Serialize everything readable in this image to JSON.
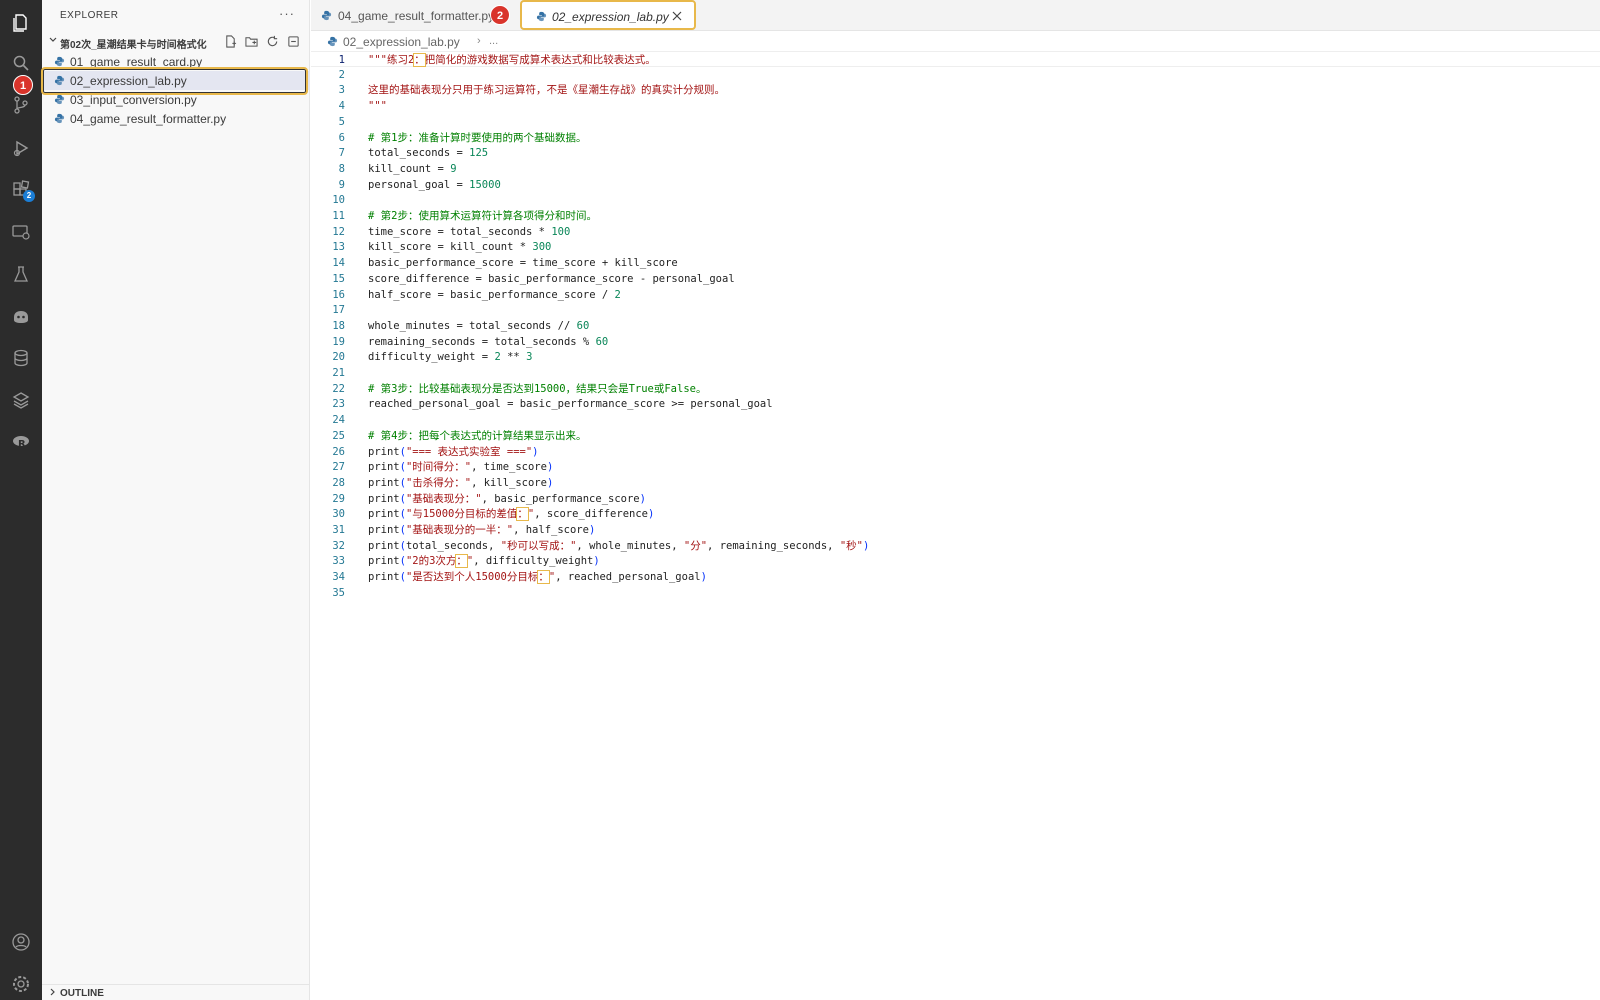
{
  "sidebar": {
    "title": "EXPLORER",
    "more": "···",
    "folder": "第02次_星潮结果卡与时间格式化",
    "files": [
      {
        "name": "01_game_result_card.py"
      },
      {
        "name": "02_expression_lab.py"
      },
      {
        "name": "03_input_conversion.py"
      },
      {
        "name": "04_game_result_formatter.py"
      }
    ],
    "outline": "OUTLINE"
  },
  "activity": {
    "extensions_badge": "2"
  },
  "markers": {
    "m1": "1",
    "m2": "2"
  },
  "tabs": [
    {
      "label": "04_game_result_formatter.py"
    },
    {
      "label": "02_expression_lab.py"
    }
  ],
  "breadcrumb": {
    "file": "02_expression_lab.py",
    "sep": "›",
    "more": "..."
  },
  "editor": {
    "lines": [
      {
        "n": "1",
        "t": [
          [
            "s",
            "\"\"\"练习2"
          ],
          [
            "b",
            "："
          ],
          [
            "s",
            "把简化的游戏数据写成算术表达式和比较表达式。"
          ]
        ]
      },
      {
        "n": "2",
        "t": []
      },
      {
        "n": "3",
        "t": [
          [
            "s",
            "这里的基础表现分只用于练习运算符，不是《星潮生存战》的真实计分规则。"
          ]
        ]
      },
      {
        "n": "4",
        "t": [
          [
            "s",
            "\"\"\""
          ]
        ]
      },
      {
        "n": "5",
        "t": []
      },
      {
        "n": "6",
        "t": [
          [
            "c",
            "# 第1步：准备计算时要使用的两个基础数据。"
          ]
        ]
      },
      {
        "n": "7",
        "t": [
          [
            "p",
            "total_seconds = "
          ],
          [
            "n",
            "125"
          ]
        ]
      },
      {
        "n": "8",
        "t": [
          [
            "p",
            "kill_count = "
          ],
          [
            "n",
            "9"
          ]
        ]
      },
      {
        "n": "9",
        "t": [
          [
            "p",
            "personal_goal = "
          ],
          [
            "n",
            "15000"
          ]
        ]
      },
      {
        "n": "10",
        "t": []
      },
      {
        "n": "11",
        "t": [
          [
            "c",
            "# 第2步：使用算术运算符计算各项得分和时间。"
          ]
        ]
      },
      {
        "n": "12",
        "t": [
          [
            "p",
            "time_score = total_seconds * "
          ],
          [
            "n",
            "100"
          ]
        ]
      },
      {
        "n": "13",
        "t": [
          [
            "p",
            "kill_score = kill_count * "
          ],
          [
            "n",
            "300"
          ]
        ]
      },
      {
        "n": "14",
        "t": [
          [
            "p",
            "basic_performance_score = time_score + kill_score"
          ]
        ]
      },
      {
        "n": "15",
        "t": [
          [
            "p",
            "score_difference = basic_performance_score - personal_goal"
          ]
        ]
      },
      {
        "n": "16",
        "t": [
          [
            "p",
            "half_score = basic_performance_score / "
          ],
          [
            "n",
            "2"
          ]
        ]
      },
      {
        "n": "17",
        "t": []
      },
      {
        "n": "18",
        "t": [
          [
            "p",
            "whole_minutes = total_seconds // "
          ],
          [
            "n",
            "60"
          ]
        ]
      },
      {
        "n": "19",
        "t": [
          [
            "p",
            "remaining_seconds = total_seconds % "
          ],
          [
            "n",
            "60"
          ]
        ]
      },
      {
        "n": "20",
        "t": [
          [
            "p",
            "difficulty_weight = "
          ],
          [
            "n",
            "2"
          ],
          [
            "p",
            " ** "
          ],
          [
            "n",
            "3"
          ]
        ]
      },
      {
        "n": "21",
        "t": []
      },
      {
        "n": "22",
        "t": [
          [
            "c",
            "# 第3步：比较基础表现分是否达到15000，结果只会是True或False。"
          ]
        ]
      },
      {
        "n": "23",
        "t": [
          [
            "p",
            "reached_personal_goal = basic_performance_score >= personal_goal"
          ]
        ]
      },
      {
        "n": "24",
        "t": []
      },
      {
        "n": "25",
        "t": [
          [
            "c",
            "# 第4步：把每个表达式的计算结果显示出来。"
          ]
        ]
      },
      {
        "n": "26",
        "t": [
          [
            "p",
            "print"
          ],
          [
            "u",
            "("
          ],
          [
            "s",
            "\"=== 表达式实验室 ===\""
          ],
          [
            "u",
            ")"
          ]
        ]
      },
      {
        "n": "27",
        "t": [
          [
            "p",
            "print"
          ],
          [
            "u",
            "("
          ],
          [
            "s",
            "\"时间得分：\""
          ],
          [
            "p",
            ", time_score"
          ],
          [
            "u",
            ")"
          ]
        ]
      },
      {
        "n": "28",
        "t": [
          [
            "p",
            "print"
          ],
          [
            "u",
            "("
          ],
          [
            "s",
            "\"击杀得分：\""
          ],
          [
            "p",
            ", kill_score"
          ],
          [
            "u",
            ")"
          ]
        ]
      },
      {
        "n": "29",
        "t": [
          [
            "p",
            "print"
          ],
          [
            "u",
            "("
          ],
          [
            "s",
            "\"基础表现分：\""
          ],
          [
            "p",
            ", basic_performance_score"
          ],
          [
            "u",
            ")"
          ]
        ]
      },
      {
        "n": "30",
        "t": [
          [
            "p",
            "print"
          ],
          [
            "u",
            "("
          ],
          [
            "s",
            "\"与15000分目标的差值"
          ],
          [
            "b",
            "："
          ],
          [
            "s",
            "\""
          ],
          [
            "p",
            ", score_difference"
          ],
          [
            "u",
            ")"
          ]
        ]
      },
      {
        "n": "31",
        "t": [
          [
            "p",
            "print"
          ],
          [
            "u",
            "("
          ],
          [
            "s",
            "\"基础表现分的一半：\""
          ],
          [
            "p",
            ", half_score"
          ],
          [
            "u",
            ")"
          ]
        ]
      },
      {
        "n": "32",
        "t": [
          [
            "p",
            "print"
          ],
          [
            "u",
            "("
          ],
          [
            "p",
            "total_seconds, "
          ],
          [
            "s",
            "\"秒可以写成：\""
          ],
          [
            "p",
            ", whole_minutes, "
          ],
          [
            "s",
            "\"分\""
          ],
          [
            "p",
            ", remaining_seconds, "
          ],
          [
            "s",
            "\"秒\""
          ],
          [
            "u",
            ")"
          ]
        ]
      },
      {
        "n": "33",
        "t": [
          [
            "p",
            "print"
          ],
          [
            "u",
            "("
          ],
          [
            "s",
            "\"2的3次方"
          ],
          [
            "b",
            "："
          ],
          [
            "s",
            "\""
          ],
          [
            "p",
            ", difficulty_weight"
          ],
          [
            "u",
            ")"
          ]
        ]
      },
      {
        "n": "34",
        "t": [
          [
            "p",
            "print"
          ],
          [
            "u",
            "("
          ],
          [
            "s",
            "\"是否达到个人15000分目标"
          ],
          [
            "b",
            "："
          ],
          [
            "s",
            "\""
          ],
          [
            "p",
            ", reached_personal_goal"
          ],
          [
            "u",
            ")"
          ]
        ]
      },
      {
        "n": "35",
        "t": []
      }
    ]
  }
}
